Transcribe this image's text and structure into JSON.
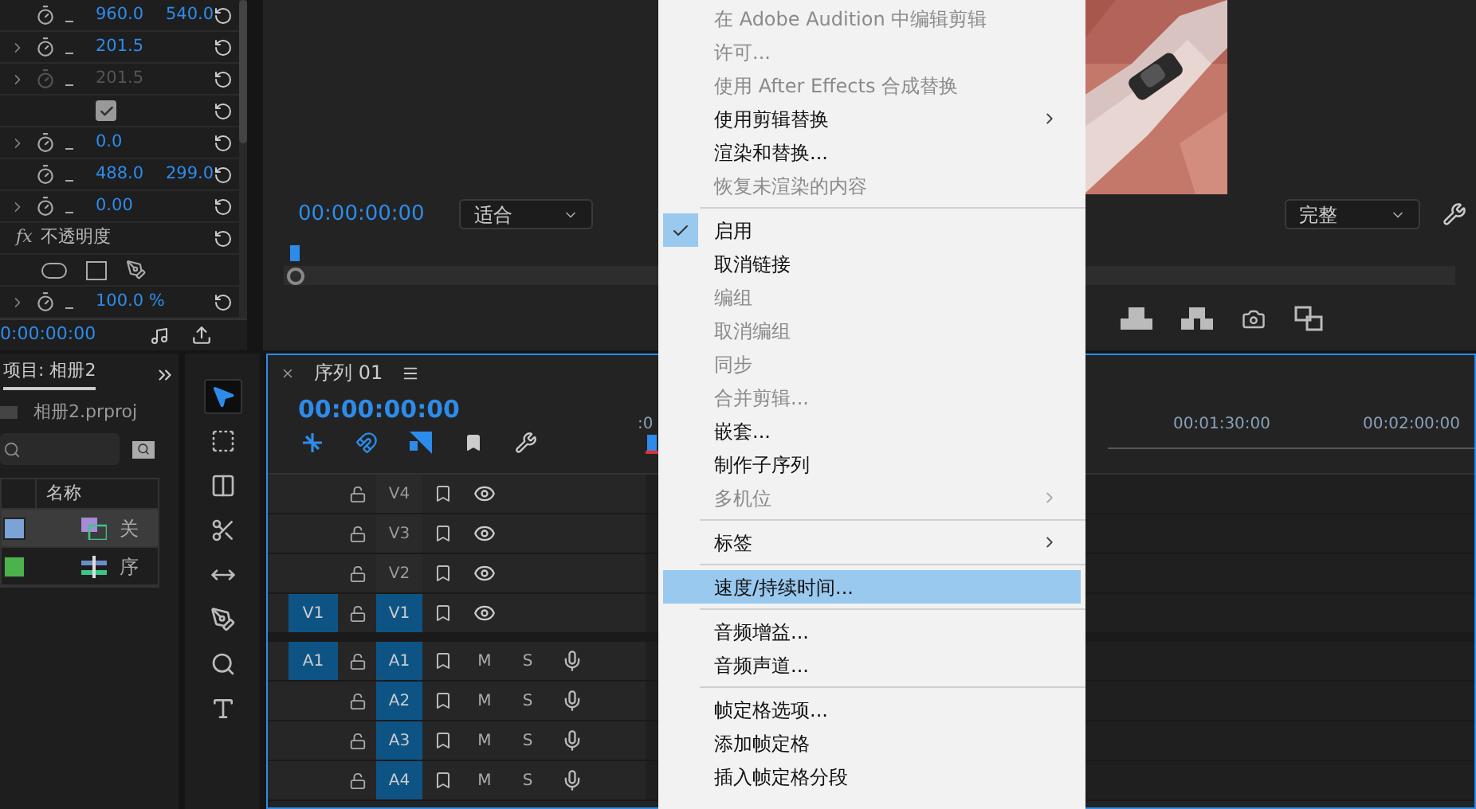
{
  "effect_controls": {
    "rows": [
      {
        "kind": "param",
        "expandable": false,
        "disabled": false,
        "values": [
          "960.0",
          "540.0"
        ]
      },
      {
        "kind": "param",
        "expandable": true,
        "disabled": false,
        "values": [
          "201.5"
        ]
      },
      {
        "kind": "param",
        "expandable": true,
        "disabled": true,
        "values": [
          "201.5"
        ]
      },
      {
        "kind": "checkbox",
        "checked": true
      },
      {
        "kind": "param",
        "expandable": true,
        "disabled": false,
        "values": [
          "0.0"
        ]
      },
      {
        "kind": "param",
        "expandable": false,
        "disabled": false,
        "values": [
          "488.0",
          "299.0"
        ]
      },
      {
        "kind": "param",
        "expandable": true,
        "disabled": false,
        "values": [
          "0.00"
        ]
      },
      {
        "kind": "effect",
        "icon_text": "fx",
        "label": "不透明度"
      },
      {
        "kind": "masks"
      },
      {
        "kind": "param",
        "expandable": true,
        "disabled": false,
        "values": [
          "100.0 %"
        ]
      }
    ],
    "timecode": "0:00:00:00"
  },
  "program_monitor": {
    "timecode": "00:00:00:00",
    "zoom": "适合",
    "quality": "完整"
  },
  "project": {
    "tab": "项目: 相册2",
    "file": "相册2.prproj",
    "column": "名称",
    "items": [
      {
        "name": "关",
        "color": "#7ba3d6",
        "kind": "clip",
        "selected": true
      },
      {
        "name": "序",
        "color": "#4cb34c",
        "kind": "sequence",
        "selected": false
      }
    ]
  },
  "tools": [
    {
      "kind": "selection",
      "selected": true
    },
    {
      "kind": "track_select",
      "selected": false
    },
    {
      "kind": "ripple",
      "selected": false
    },
    {
      "kind": "razor",
      "selected": false
    },
    {
      "kind": "slip",
      "selected": false
    },
    {
      "kind": "pen",
      "selected": false
    },
    {
      "kind": "zoom",
      "selected": false
    },
    {
      "kind": "text",
      "selected": false
    }
  ],
  "timeline": {
    "tab": "序列 01",
    "timecode": "00:00:00:00",
    "ruler": [
      ":0",
      "00:01:30:00",
      "00:02:00:00"
    ],
    "video_tracks": [
      {
        "name": "V4",
        "targeted": false
      },
      {
        "name": "V3",
        "targeted": false
      },
      {
        "name": "V2",
        "targeted": false
      },
      {
        "name": "V1",
        "source": "V1",
        "targeted": true
      }
    ],
    "audio_tracks": [
      {
        "name": "A1",
        "source": "A1",
        "targeted": true,
        "mute": "M",
        "solo": "S"
      },
      {
        "name": "A2",
        "targeted": true,
        "mute": "M",
        "solo": "S"
      },
      {
        "name": "A3",
        "targeted": true,
        "mute": "M",
        "solo": "S"
      },
      {
        "name": "A4",
        "targeted": true,
        "mute": "M",
        "solo": "S"
      }
    ]
  },
  "context_menu": [
    {
      "kind": "item",
      "label": "在 Adobe Audition 中编辑剪辑",
      "disabled": true,
      "checked": false,
      "submenu": false,
      "selected": false
    },
    {
      "kind": "item",
      "label": "许可...",
      "disabled": true,
      "checked": false,
      "submenu": false,
      "selected": false
    },
    {
      "kind": "item",
      "label": "使用 After Effects 合成替换",
      "disabled": true,
      "checked": false,
      "submenu": false,
      "selected": false
    },
    {
      "kind": "item",
      "label": "使用剪辑替换",
      "disabled": false,
      "checked": false,
      "submenu": true,
      "selected": false
    },
    {
      "kind": "item",
      "label": "渲染和替换...",
      "disabled": false,
      "checked": false,
      "submenu": false,
      "selected": false
    },
    {
      "kind": "item",
      "label": "恢复未渲染的内容",
      "disabled": true,
      "checked": false,
      "submenu": false,
      "selected": false
    },
    {
      "kind": "separator"
    },
    {
      "kind": "item",
      "label": "启用",
      "disabled": false,
      "checked": true,
      "submenu": false,
      "selected": false
    },
    {
      "kind": "item",
      "label": "取消链接",
      "disabled": false,
      "checked": false,
      "submenu": false,
      "selected": false
    },
    {
      "kind": "item",
      "label": "编组",
      "disabled": true,
      "checked": false,
      "submenu": false,
      "selected": false
    },
    {
      "kind": "item",
      "label": "取消编组",
      "disabled": true,
      "checked": false,
      "submenu": false,
      "selected": false
    },
    {
      "kind": "item",
      "label": "同步",
      "disabled": true,
      "checked": false,
      "submenu": false,
      "selected": false
    },
    {
      "kind": "item",
      "label": "合并剪辑...",
      "disabled": true,
      "checked": false,
      "submenu": false,
      "selected": false
    },
    {
      "kind": "item",
      "label": "嵌套...",
      "disabled": false,
      "checked": false,
      "submenu": false,
      "selected": false
    },
    {
      "kind": "item",
      "label": "制作子序列",
      "disabled": false,
      "checked": false,
      "submenu": false,
      "selected": false
    },
    {
      "kind": "item",
      "label": "多机位",
      "disabled": true,
      "checked": false,
      "submenu": true,
      "selected": false
    },
    {
      "kind": "separator"
    },
    {
      "kind": "item",
      "label": "标签",
      "disabled": false,
      "checked": false,
      "submenu": true,
      "selected": false
    },
    {
      "kind": "separator"
    },
    {
      "kind": "item",
      "label": "速度/持续时间...",
      "disabled": false,
      "checked": false,
      "submenu": false,
      "selected": true
    },
    {
      "kind": "separator"
    },
    {
      "kind": "item",
      "label": "音频增益...",
      "disabled": false,
      "checked": false,
      "submenu": false,
      "selected": false
    },
    {
      "kind": "item",
      "label": "音频声道...",
      "disabled": false,
      "checked": false,
      "submenu": false,
      "selected": false
    },
    {
      "kind": "separator"
    },
    {
      "kind": "item",
      "label": "帧定格选项...",
      "disabled": false,
      "checked": false,
      "submenu": false,
      "selected": false
    },
    {
      "kind": "item",
      "label": "添加帧定格",
      "disabled": false,
      "checked": false,
      "submenu": false,
      "selected": false
    },
    {
      "kind": "item",
      "label": "插入帧定格分段",
      "disabled": false,
      "checked": false,
      "submenu": false,
      "selected": false
    }
  ]
}
